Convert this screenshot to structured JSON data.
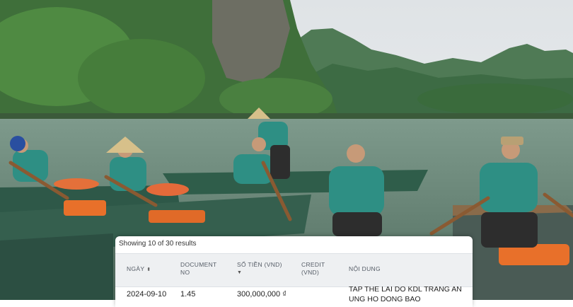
{
  "results_summary": "Showing 10 of 30 results",
  "columns": [
    {
      "label": "NGÀY",
      "sort_icon": "sort-both-icon"
    },
    {
      "label": "DOCUMENT NO"
    },
    {
      "label": "SỐ TIỀN (VND)",
      "sort_icon": "sort-down-icon"
    },
    {
      "label": "CREDIT (VND)"
    },
    {
      "label": "NỘI DUNG"
    }
  ],
  "rows": [
    {
      "date": "2024-09-10",
      "document_no": "1.45",
      "amount": "300,000,000 ₫",
      "credit": "",
      "content": "TAP THE LAI DO KDL TRANG AN UNG HO DONG BAO"
    }
  ],
  "colors": {
    "water": "#5f7e6e",
    "boat_green": "#2f5d4a",
    "header_bg": "#eef0f2"
  }
}
